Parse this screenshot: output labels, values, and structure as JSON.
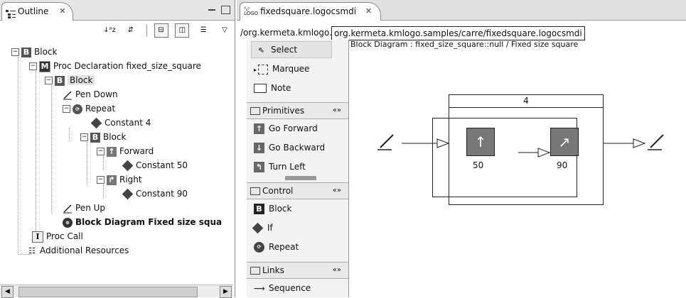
{
  "outline": {
    "tab_label": "Outline",
    "close_glyph": "✕",
    "tree": [
      {
        "label": "Block",
        "icon": "block-icon",
        "level": 0,
        "toggle": "−"
      },
      {
        "label": "Proc Declaration fixed_size_square",
        "icon": "procedure-icon",
        "level": 1,
        "toggle": "−"
      },
      {
        "label": "Block",
        "icon": "block-icon",
        "level": 2,
        "toggle": "−",
        "selected": true
      },
      {
        "label": "Pen Down",
        "icon": "pen-icon",
        "level": 3
      },
      {
        "label": "Repeat",
        "icon": "repeat-icon",
        "level": 3,
        "toggle": "−"
      },
      {
        "label": "Constant 4",
        "icon": "constant-icon",
        "level": 4
      },
      {
        "label": "Block",
        "icon": "block-icon",
        "level": 4,
        "toggle": "−"
      },
      {
        "label": "Forward",
        "icon": "forward-icon",
        "level": 5,
        "toggle": "−"
      },
      {
        "label": "Constant 50",
        "icon": "constant-icon",
        "level": 6
      },
      {
        "label": "Right",
        "icon": "right-icon",
        "level": 5,
        "toggle": "−"
      },
      {
        "label": "Constant 90",
        "icon": "constant-icon",
        "level": 6
      },
      {
        "label": "Pen Up",
        "icon": "pen-icon",
        "level": 3
      },
      {
        "label": "Block Diagram Fixed size squa",
        "icon": "diagram-icon",
        "level": 3,
        "bold": true
      },
      {
        "label": "Proc Call",
        "icon": "proc-call-icon",
        "level": 1
      },
      {
        "label": "Additional Resources",
        "icon": "resources-icon",
        "level": 0
      }
    ]
  },
  "editor": {
    "tab_label": "fixedsquare.logocsmdi",
    "logo_glyph_top": "⁰ₐ⁰",
    "logo_glyph_bottom": "LOGO",
    "close_glyph": "✕",
    "path_short": "/org.kermeta.kmlogo.s",
    "path_tooltip": "org.kermeta.kmlogo.samples/carre/fixedsquare.logocsmdi",
    "diagram_title": "Block Diagram : fixed_size_square::null / Fixed size square"
  },
  "palette": {
    "tools": [
      {
        "label": "Select",
        "icon": "pointer-icon"
      },
      {
        "label": "Marquee",
        "icon": "marquee-icon"
      },
      {
        "label": "Note",
        "icon": "note-icon"
      }
    ],
    "drawers": [
      {
        "label": "Primitives",
        "items": [
          "Go Forward",
          "Go Backward",
          "Turn Left"
        ]
      },
      {
        "label": "Control",
        "items": [
          "Block",
          "If",
          "Repeat"
        ]
      },
      {
        "label": "Links",
        "items": [
          "Sequence"
        ]
      }
    ],
    "chevron": "«»"
  },
  "diagram": {
    "repeat_count": "4",
    "forward_value": "50",
    "turn_value": "90"
  }
}
